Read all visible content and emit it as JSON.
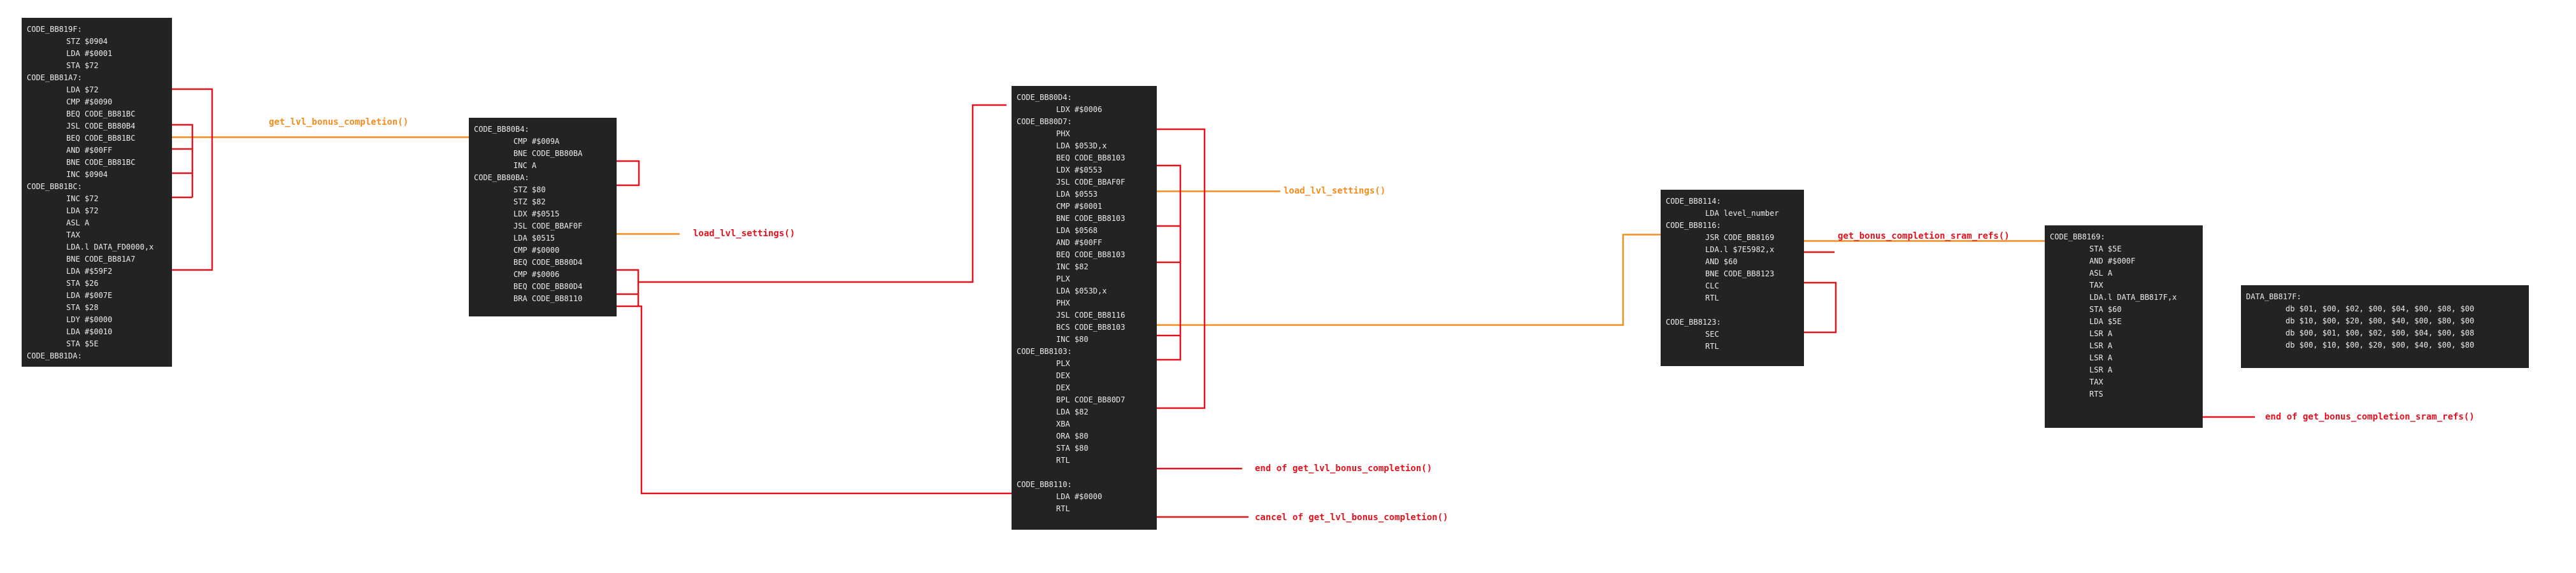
{
  "colors": {
    "background": "#ffffff",
    "block": "#232323",
    "code_text": "#ececec",
    "call_link": "#f48c1e",
    "branch_link": "#e2121e"
  },
  "blocks": [
    {
      "id": "b1",
      "lines": [
        {
          "t": "CODE_BB819F:",
          "k": "lbl"
        },
        {
          "t": "STZ $0904",
          "k": "ins"
        },
        {
          "t": "LDA #$0001",
          "k": "ins"
        },
        {
          "t": "STA $72",
          "k": "ins"
        },
        {
          "t": "CODE_BB81A7:",
          "k": "lbl"
        },
        {
          "t": "LDA $72",
          "k": "ins"
        },
        {
          "t": "CMP #$0090",
          "k": "ins"
        },
        {
          "t": "BEQ CODE_BB81BC",
          "k": "ins"
        },
        {
          "t": "JSL CODE_BB80B4",
          "k": "ins"
        },
        {
          "t": "BEQ CODE_BB81BC",
          "k": "ins"
        },
        {
          "t": "AND #$00FF",
          "k": "ins"
        },
        {
          "t": "BNE CODE_BB81BC",
          "k": "ins"
        },
        {
          "t": "INC $0904",
          "k": "ins"
        },
        {
          "t": "CODE_BB81BC:",
          "k": "lbl"
        },
        {
          "t": "INC $72",
          "k": "ins"
        },
        {
          "t": "LDA $72",
          "k": "ins"
        },
        {
          "t": "ASL A",
          "k": "ins"
        },
        {
          "t": "TAX",
          "k": "ins"
        },
        {
          "t": "LDA.l DATA_FD0000,x",
          "k": "ins"
        },
        {
          "t": "BNE CODE_BB81A7",
          "k": "ins"
        },
        {
          "t": "LDA #$59F2",
          "k": "ins"
        },
        {
          "t": "STA $26",
          "k": "ins"
        },
        {
          "t": "LDA #$007E",
          "k": "ins"
        },
        {
          "t": "STA $28",
          "k": "ins"
        },
        {
          "t": "LDY #$0000",
          "k": "ins"
        },
        {
          "t": "LDA #$0010",
          "k": "ins"
        },
        {
          "t": "STA $5E",
          "k": "ins"
        },
        {
          "t": "CODE_BB81DA:",
          "k": "lbl"
        }
      ]
    },
    {
      "id": "b2",
      "lines": [
        {
          "t": "CODE_BB80B4:",
          "k": "lbl"
        },
        {
          "t": "CMP #$009A",
          "k": "ins"
        },
        {
          "t": "BNE CODE_BB80BA",
          "k": "ins"
        },
        {
          "t": "INC A",
          "k": "ins"
        },
        {
          "t": "CODE_BB80BA:",
          "k": "lbl"
        },
        {
          "t": "STZ $80",
          "k": "ins"
        },
        {
          "t": "STZ $82",
          "k": "ins"
        },
        {
          "t": "LDX #$0515",
          "k": "ins"
        },
        {
          "t": "JSL CODE_BBAF0F",
          "k": "ins"
        },
        {
          "t": "LDA $0515",
          "k": "ins"
        },
        {
          "t": "CMP #$0000",
          "k": "ins"
        },
        {
          "t": "BEQ CODE_BB80D4",
          "k": "ins"
        },
        {
          "t": "CMP #$0006",
          "k": "ins"
        },
        {
          "t": "BEQ CODE_BB80D4",
          "k": "ins"
        },
        {
          "t": "BRA CODE_BB8110",
          "k": "ins"
        }
      ]
    },
    {
      "id": "b3",
      "lines": [
        {
          "t": "CODE_BB80D4:",
          "k": "lbl"
        },
        {
          "t": "LDX #$0006",
          "k": "ins"
        },
        {
          "t": "CODE_BB80D7:",
          "k": "lbl"
        },
        {
          "t": "PHX",
          "k": "ins"
        },
        {
          "t": "LDA $053D,x",
          "k": "ins"
        },
        {
          "t": "BEQ CODE_BB8103",
          "k": "ins"
        },
        {
          "t": "LDX #$0553",
          "k": "ins"
        },
        {
          "t": "JSL CODE_BBAF0F",
          "k": "ins"
        },
        {
          "t": "LDA $0553",
          "k": "ins"
        },
        {
          "t": "CMP #$0001",
          "k": "ins"
        },
        {
          "t": "BNE CODE_BB8103",
          "k": "ins"
        },
        {
          "t": "LDA $0568",
          "k": "ins"
        },
        {
          "t": "AND #$00FF",
          "k": "ins"
        },
        {
          "t": "BEQ CODE_BB8103",
          "k": "ins"
        },
        {
          "t": "INC $82",
          "k": "ins"
        },
        {
          "t": "PLX",
          "k": "ins"
        },
        {
          "t": "LDA $053D,x",
          "k": "ins"
        },
        {
          "t": "PHX",
          "k": "ins"
        },
        {
          "t": "JSL CODE_BB8116",
          "k": "ins"
        },
        {
          "t": "BCS CODE_BB8103",
          "k": "ins"
        },
        {
          "t": "INC $80",
          "k": "ins"
        },
        {
          "t": "CODE_BB8103:",
          "k": "lbl"
        },
        {
          "t": "PLX",
          "k": "ins"
        },
        {
          "t": "DEX",
          "k": "ins"
        },
        {
          "t": "DEX",
          "k": "ins"
        },
        {
          "t": "BPL CODE_BB80D7",
          "k": "ins"
        },
        {
          "t": "LDA $82",
          "k": "ins"
        },
        {
          "t": "XBA",
          "k": "ins"
        },
        {
          "t": "ORA $80",
          "k": "ins"
        },
        {
          "t": "STA $80",
          "k": "ins"
        },
        {
          "t": "RTL",
          "k": "ins"
        },
        {
          "t": "",
          "k": "ins"
        },
        {
          "t": "CODE_BB8110:",
          "k": "lbl"
        },
        {
          "t": "LDA #$0000",
          "k": "ins"
        },
        {
          "t": "RTL",
          "k": "ins"
        }
      ]
    },
    {
      "id": "b4",
      "lines": [
        {
          "t": "CODE_BB8114:",
          "k": "lbl"
        },
        {
          "t": "LDA level_number",
          "k": "ins"
        },
        {
          "t": "CODE_BB8116:",
          "k": "lbl"
        },
        {
          "t": "JSR CODE_BB8169",
          "k": "ins"
        },
        {
          "t": "LDA.l $7E5982,x",
          "k": "ins"
        },
        {
          "t": "AND $60",
          "k": "ins"
        },
        {
          "t": "BNE CODE_BB8123",
          "k": "ins"
        },
        {
          "t": "CLC",
          "k": "ins"
        },
        {
          "t": "RTL",
          "k": "ins"
        },
        {
          "t": "",
          "k": "ins"
        },
        {
          "t": "CODE_BB8123:",
          "k": "lbl"
        },
        {
          "t": "SEC",
          "k": "ins"
        },
        {
          "t": "RTL",
          "k": "ins"
        }
      ]
    },
    {
      "id": "b5",
      "lines": [
        {
          "t": "CODE_BB8169:",
          "k": "lbl"
        },
        {
          "t": "STA $5E",
          "k": "ins"
        },
        {
          "t": "AND #$000F",
          "k": "ins"
        },
        {
          "t": "ASL A",
          "k": "ins"
        },
        {
          "t": "TAX",
          "k": "ins"
        },
        {
          "t": "LDA.l DATA_BB817F,x",
          "k": "ins"
        },
        {
          "t": "STA $60",
          "k": "ins"
        },
        {
          "t": "LDA $5E",
          "k": "ins"
        },
        {
          "t": "LSR A",
          "k": "ins"
        },
        {
          "t": "LSR A",
          "k": "ins"
        },
        {
          "t": "LSR A",
          "k": "ins"
        },
        {
          "t": "LSR A",
          "k": "ins"
        },
        {
          "t": "TAX",
          "k": "ins"
        },
        {
          "t": "RTS",
          "k": "ins"
        }
      ]
    },
    {
      "id": "b6",
      "lines": [
        {
          "t": "DATA_BB817F:",
          "k": "lbl"
        },
        {
          "t": "db $01, $00, $02, $00, $04, $00, $08, $00",
          "k": "ins"
        },
        {
          "t": "db $10, $00, $20, $00, $40, $00, $80, $00",
          "k": "ins"
        },
        {
          "t": "db $00, $01, $00, $02, $00, $04, $00, $08",
          "k": "ins"
        },
        {
          "t": "db $00, $10, $00, $20, $00, $40, $00, $80",
          "k": "ins"
        }
      ]
    }
  ],
  "annotations": {
    "get_lvl_bonus_completion": "get_lvl_bonus_completion()",
    "load_lvl_settings_1": "load_lvl_settings()",
    "load_lvl_settings_2": "load_lvl_settings()",
    "end_get_lvl_bonus_completion": "end of get_lvl_bonus_completion()",
    "cancel_get_lvl_bonus_completion": "cancel of get_lvl_bonus_completion()",
    "get_bonus_completion_sram_refs": "get_bonus_completion_sram_refs()",
    "end_get_bonus_completion_sram_refs": "end of get_bonus_completion_sram_refs()"
  }
}
